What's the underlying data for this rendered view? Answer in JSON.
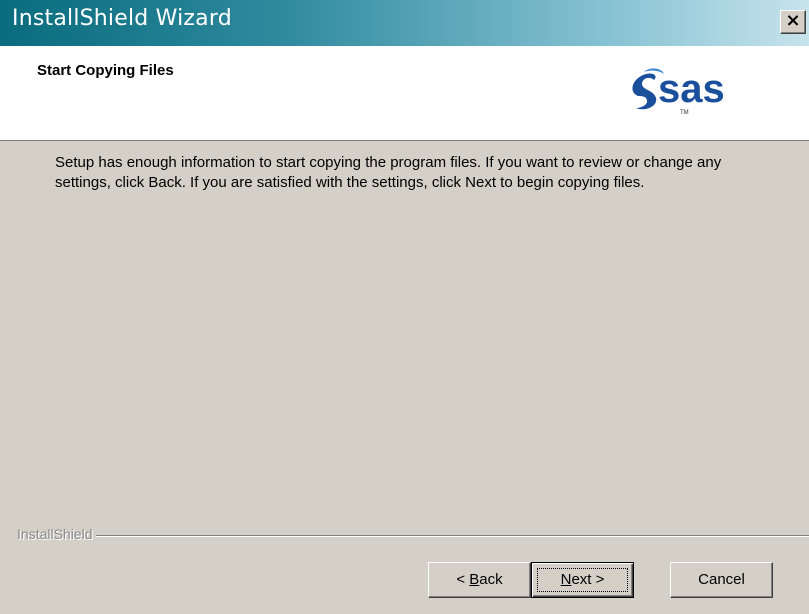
{
  "window": {
    "title": "InstallShield Wizard",
    "close_glyph": "×"
  },
  "header": {
    "title": "Start Copying Files",
    "logo_text": "sas",
    "logo_tm": "TM"
  },
  "body": {
    "text": "Setup has enough information to start copying the program files.  If you want to review or change any settings, click Back.  If you are satisfied with the settings, click Next to begin copying files."
  },
  "footer": {
    "brand_label": "InstallShield"
  },
  "buttons": {
    "back": {
      "mnemonic": "B",
      "rest": "ack",
      "prefix": "< "
    },
    "next": {
      "mnemonic": "N",
      "rest": "ext >",
      "prefix": ""
    },
    "cancel_label": "Cancel"
  },
  "colors": {
    "titlebar_start": "#0a6c7e",
    "titlebar_end": "#c7e3ec",
    "logo_blue": "#1a4f9c",
    "face": "#d4d0c8"
  },
  "icons": {
    "close": "close-icon",
    "logo": "sas-logo-icon"
  }
}
